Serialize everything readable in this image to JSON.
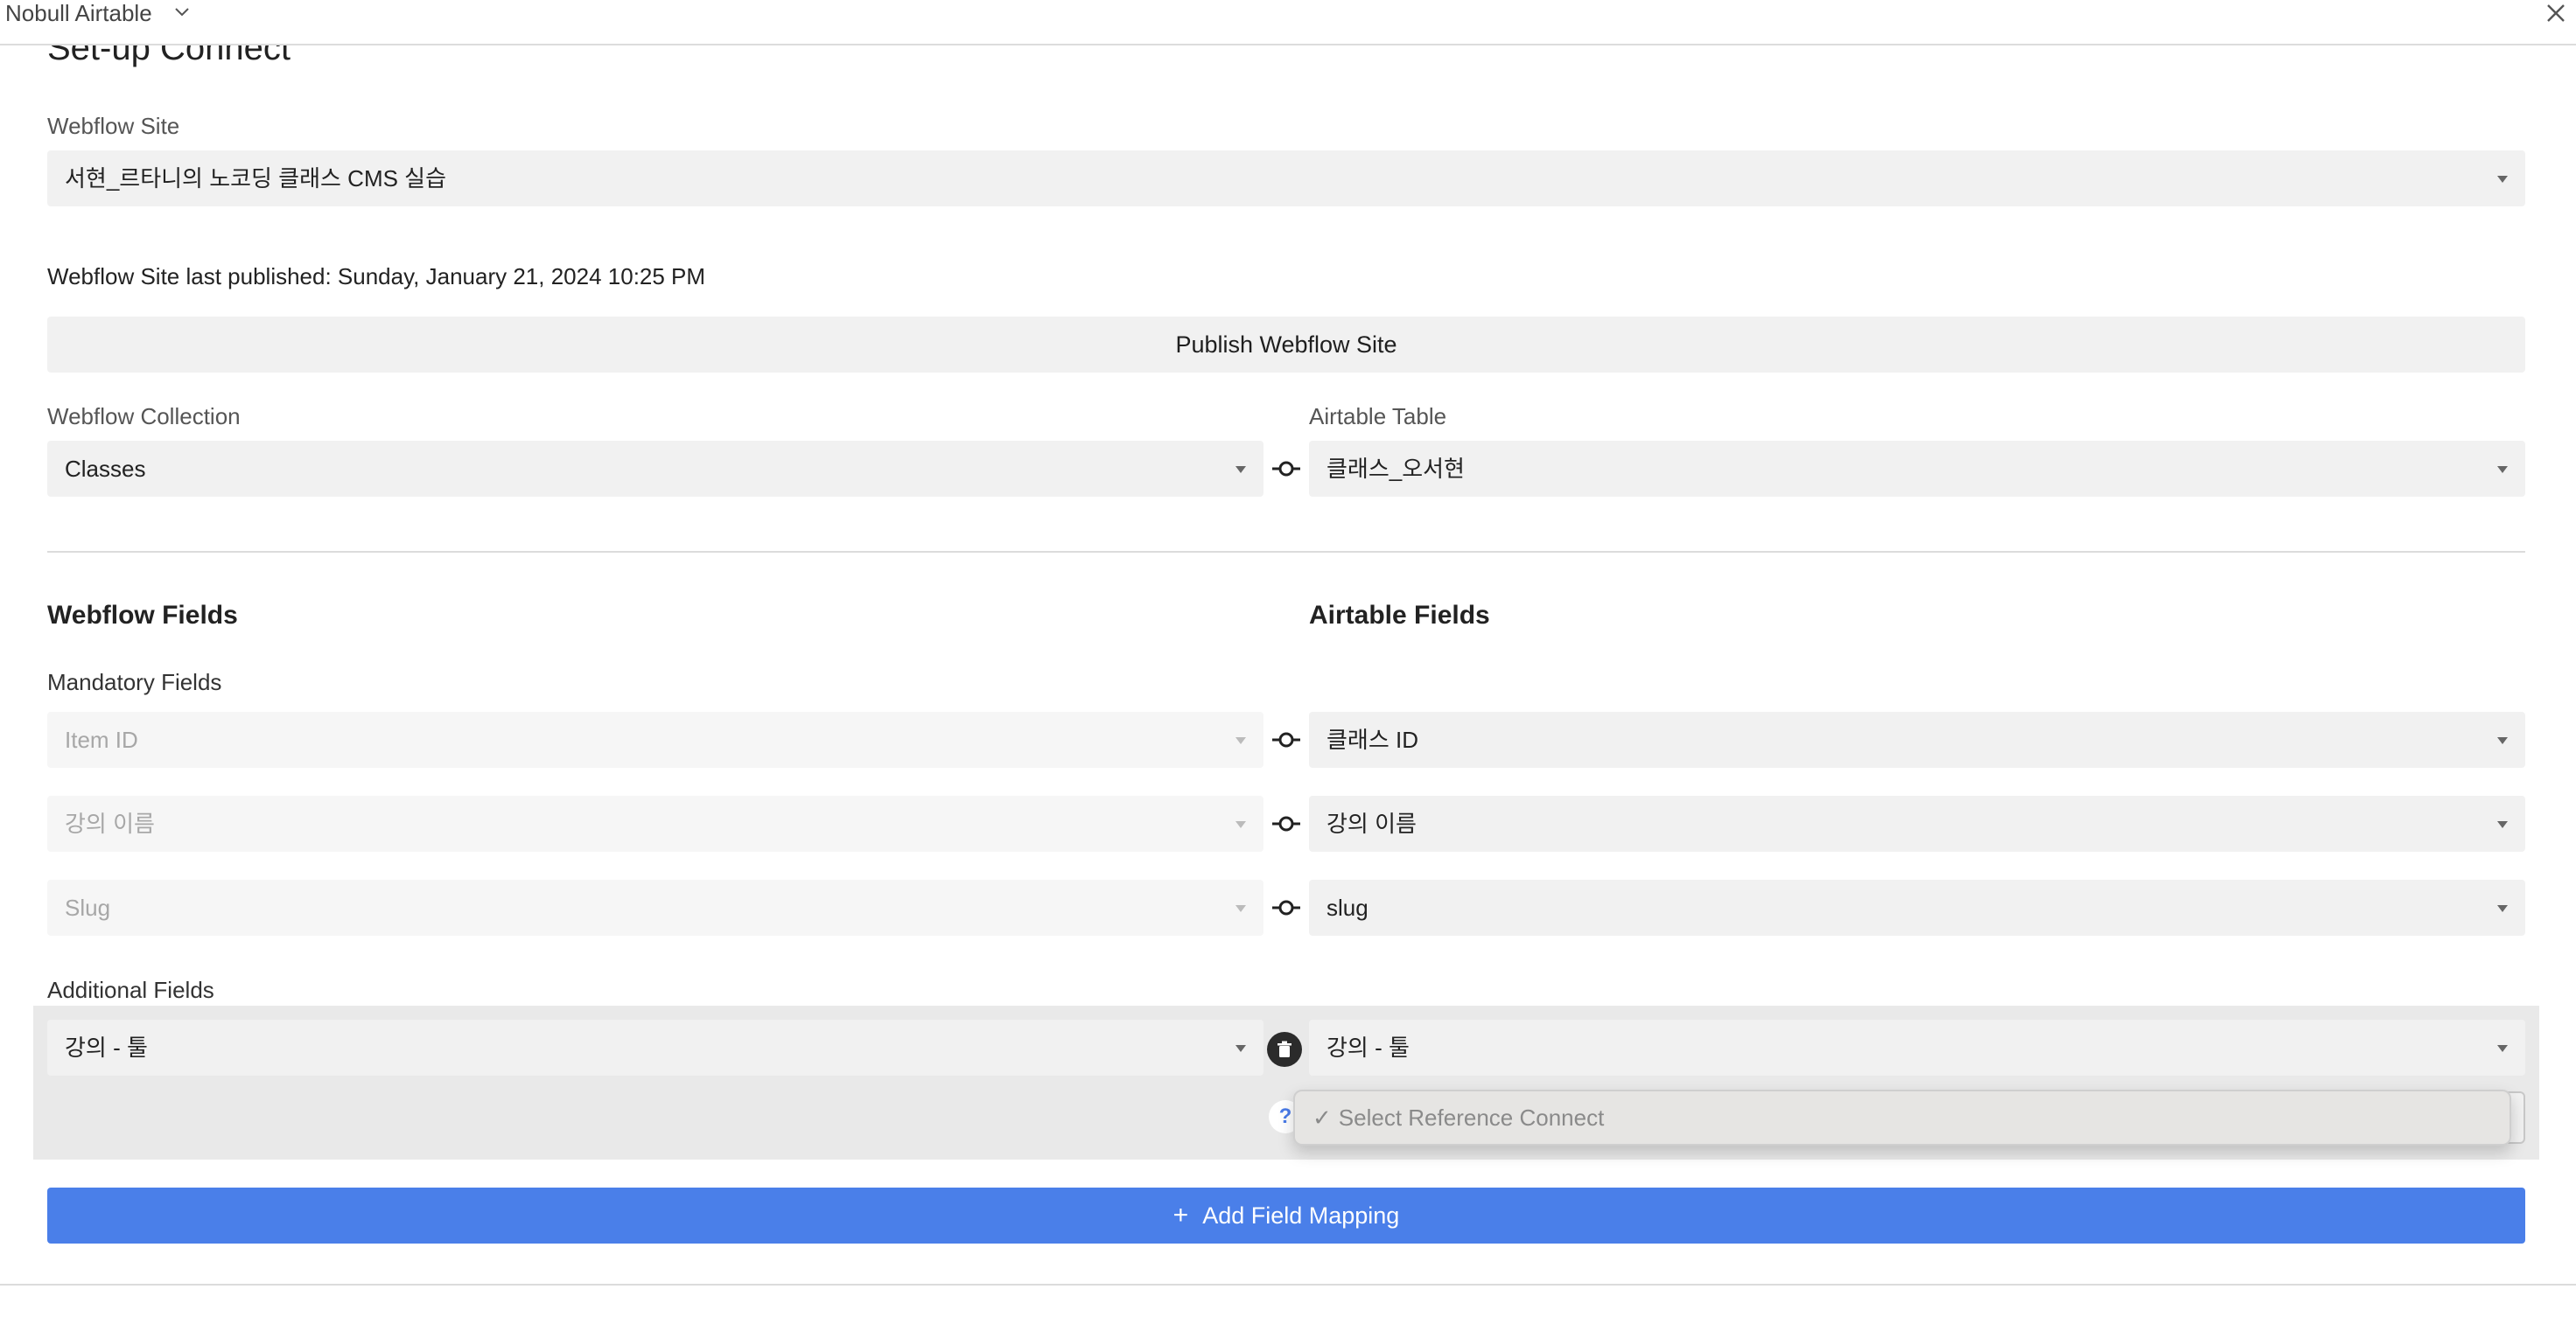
{
  "topbar": {
    "app_name": "Nobull Airtable",
    "chevron_icon": "chevron-down-icon",
    "close_icon": "close-icon"
  },
  "page_title": "Set-up Connect",
  "webflow_site": {
    "label": "Webflow Site",
    "value": "서현_르타니의 노코딩 클래스 CMS 실습"
  },
  "last_published": "Webflow Site last published: Sunday, January 21, 2024 10:25 PM",
  "publish_button": "Publish Webflow Site",
  "collection": {
    "label": "Webflow Collection",
    "value": "Classes"
  },
  "airtable_table": {
    "label": "Airtable Table",
    "value": "클래스_오서현"
  },
  "fields": {
    "webflow_title": "Webflow Fields",
    "airtable_title": "Airtable Fields",
    "mandatory_label": "Mandatory Fields",
    "mandatory": [
      {
        "webflow": "Item ID",
        "airtable": "클래스 ID"
      },
      {
        "webflow": "강의 이름",
        "airtable": "강의 이름"
      },
      {
        "webflow": "Slug",
        "airtable": "slug"
      }
    ],
    "additional_label": "Additional Fields",
    "additional": [
      {
        "webflow": "강의 - 툴",
        "airtable": "강의 - 툴",
        "reference_placeholder": "Select Reference Connect",
        "help": "?"
      }
    ]
  },
  "add_button": {
    "icon": "+",
    "label": "Add Field Mapping"
  },
  "colors": {
    "accent": "#4a7fe9",
    "field_bg": "#f1f1f1",
    "row_bg": "#e9e9e9"
  }
}
